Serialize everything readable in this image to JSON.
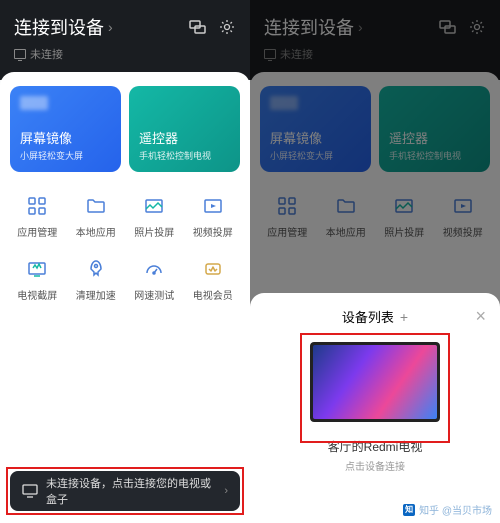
{
  "header": {
    "title": "连接到设备",
    "status": "未连接"
  },
  "cards": {
    "mirror": {
      "title": "屏幕镜像",
      "sub": "小屏轻松变大屏"
    },
    "remote": {
      "title": "遥控器",
      "sub": "手机轻松控制电视"
    }
  },
  "grid": [
    {
      "label": "应用管理"
    },
    {
      "label": "本地应用"
    },
    {
      "label": "照片投屏"
    },
    {
      "label": "视频投屏"
    },
    {
      "label": "电视截屏"
    },
    {
      "label": "清理加速"
    },
    {
      "label": "网速测试"
    },
    {
      "label": "电视会员"
    }
  ],
  "banner": {
    "text": "未连接设备，点击连接您的电视或盒子"
  },
  "sheet": {
    "title": "设备列表",
    "device_name": "客厅的Redmi电视",
    "device_hint": "点击设备连接"
  },
  "watermark": "知乎 @当贝市场"
}
